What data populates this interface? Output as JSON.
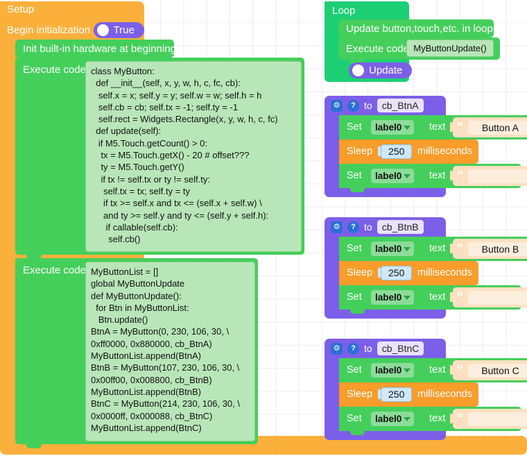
{
  "app": {
    "type": "blockly-visual-programming-canvas"
  },
  "setup": {
    "title": "Setup",
    "begin_initialization_label": "Begin initialization",
    "begin_initialization_value": "True",
    "init_hardware_label": "Init built-in hardware at beginning",
    "execute_code_label": "Execute code",
    "code_1": "class MyButton:\n  def __init__(self, x, y, w, h, c, fc, cb):\n   self.x = x; self.y = y; self.w = w; self.h = h\n   self.cb = cb; self.tx = -1; self.ty = -1\n   self.rect = Widgets.Rectangle(x, y, w, h, c, fc)\n  def update(self):\n   if M5.Touch.getCount() > 0:\n    tx = M5.Touch.getX() - 20 # offset???\n    ty = M5.Touch.getY()\n    if tx != self.tx or ty != self.ty:\n     self.tx = tx; self.ty = ty\n     if tx >= self.x and tx <= (self.x + self.w) \\\n     and ty >= self.y and ty <= (self.y + self.h):\n      if callable(self.cb):\n       self.cb()",
    "code_2": "MyButtonList = []\nglobal MyButtonUpdate\ndef MyButtonUpdate():\n  for Btn in MyButtonList:\n   Btn.update()\nBtnA = MyButton(0, 230, 106, 30, \\\n0xff0000, 0x880000, cb_BtnA)\nMyButtonList.append(BtnA)\nBtnB = MyButton(107, 230, 106, 30, \\\n0x00ff00, 0x008800, cb_BtnB)\nMyButtonList.append(BtnB)\nBtnC = MyButton(214, 230, 106, 30, \\\n0x0000ff, 0x000088, cb_BtnC)\nMyButtonList.append(BtnC)"
  },
  "loop": {
    "title": "Loop",
    "update_banner_label": "Update button,touch,etc. in loop",
    "execute_code_label": "Execute code",
    "execute_code_value": "MyButtonUpdate()",
    "update_pill_label": "Update"
  },
  "callbacks": [
    {
      "gear_icon": "gear-icon",
      "help_icon": "help-icon",
      "to_label": "to",
      "name": "cb_BtnA",
      "rows": [
        {
          "kind": "set-label-text",
          "set_label": "Set",
          "target": "label0",
          "text_label": "text",
          "value": "Button A"
        },
        {
          "kind": "sleep",
          "sleep_label": "Sleep",
          "amount": "250",
          "unit_label": "milliseconds"
        },
        {
          "kind": "set-label-text",
          "set_label": "Set",
          "target": "label0",
          "text_label": "text",
          "value": ""
        }
      ]
    },
    {
      "gear_icon": "gear-icon",
      "help_icon": "help-icon",
      "to_label": "to",
      "name": "cb_BtnB",
      "rows": [
        {
          "kind": "set-label-text",
          "set_label": "Set",
          "target": "label0",
          "text_label": "text",
          "value": "Button B"
        },
        {
          "kind": "sleep",
          "sleep_label": "Sleep",
          "amount": "250",
          "unit_label": "milliseconds"
        },
        {
          "kind": "set-label-text",
          "set_label": "Set",
          "target": "label0",
          "text_label": "text",
          "value": ""
        }
      ]
    },
    {
      "gear_icon": "gear-icon",
      "help_icon": "help-icon",
      "to_label": "to",
      "name": "cb_BtnC",
      "rows": [
        {
          "kind": "set-label-text",
          "set_label": "Set",
          "target": "label0",
          "text_label": "text",
          "value": "Button C"
        },
        {
          "kind": "sleep",
          "sleep_label": "Sleep",
          "amount": "250",
          "unit_label": "milliseconds"
        },
        {
          "kind": "set-label-text",
          "set_label": "Set",
          "target": "label0",
          "text_label": "text",
          "value": ""
        }
      ]
    }
  ],
  "colors": {
    "setup_orange": "#fbb03b",
    "statement_green": "#44cf5b",
    "loop_green": "#1ccf74",
    "function_purple": "#7c5fe8",
    "sleep_orange": "#f89c2a",
    "code_area_green": "#b8e6b8",
    "string_field": "#fce0c0",
    "number_field": "#cfe8fa",
    "icon_blue": "#2b6fd6"
  }
}
